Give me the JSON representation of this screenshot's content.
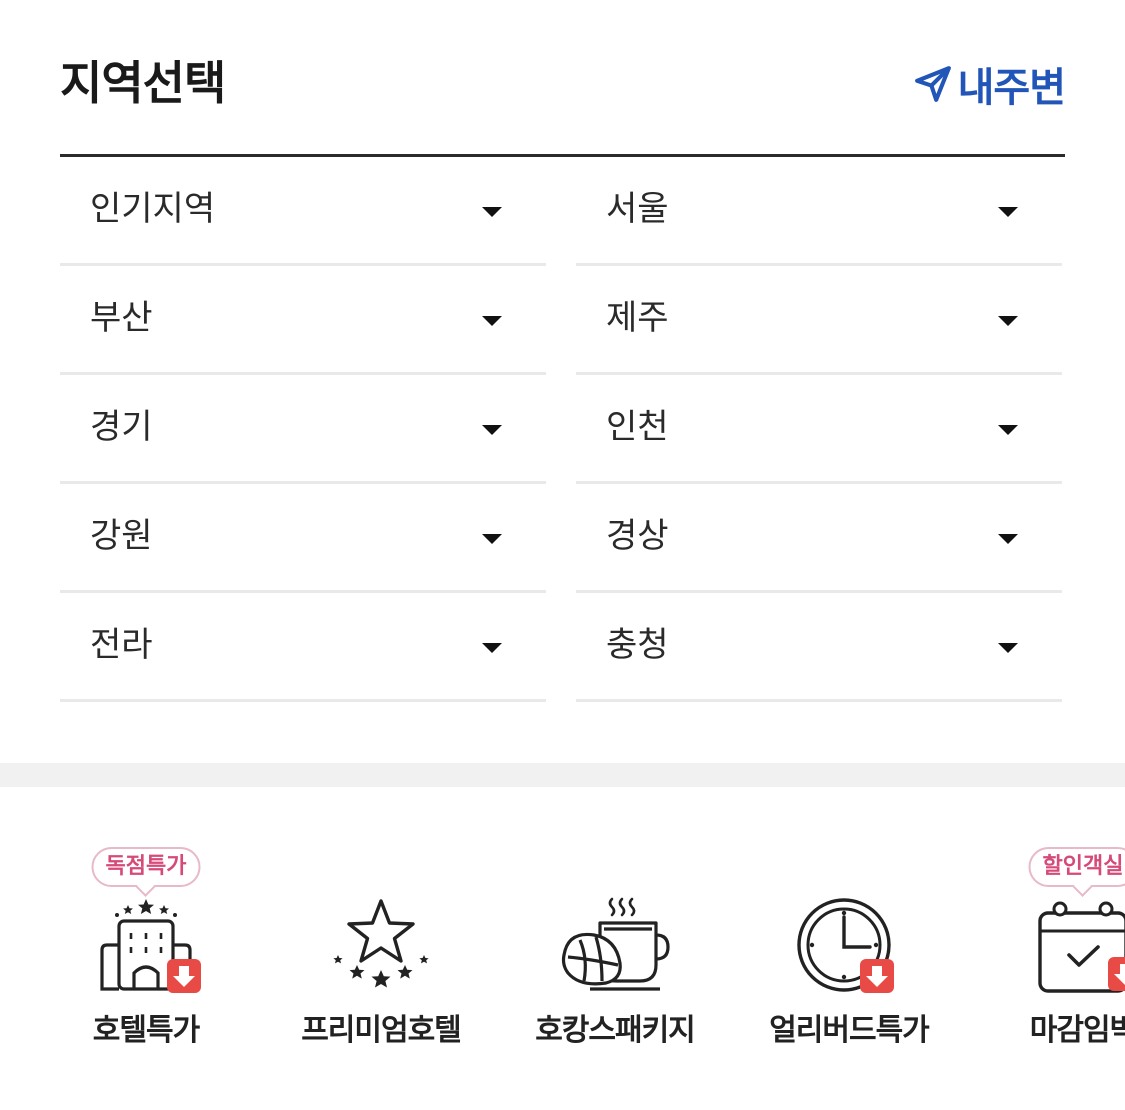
{
  "header": {
    "title": "지역선택",
    "nearby_label": "내주변",
    "nearby_icon": "navigation-arrow-icon",
    "accent": "#2255b8"
  },
  "regions": [
    [
      "인기지역",
      "서울"
    ],
    [
      "부산",
      "제주"
    ],
    [
      "경기",
      "인천"
    ],
    [
      "강원",
      "경상"
    ],
    [
      "전라",
      "충청"
    ]
  ],
  "shortcuts": [
    {
      "label": "호텔특가",
      "badge": "독점특가",
      "icon": "hotel-building-icon",
      "download_badge": true
    },
    {
      "label": "프리미엄호텔",
      "badge": "",
      "icon": "star-icon",
      "download_badge": false
    },
    {
      "label": "호캉스패키지",
      "badge": "",
      "icon": "croissant-coffee-icon",
      "download_badge": false
    },
    {
      "label": "얼리버드특가",
      "badge": "",
      "icon": "clock-icon",
      "download_badge": true
    },
    {
      "label": "마감임박",
      "badge": "할인객실",
      "icon": "calendar-check-icon",
      "download_badge": true
    }
  ],
  "colors": {
    "badge_text": "#d64a78",
    "badge_border": "#e7b9c9",
    "download_red": "#e84b45"
  }
}
